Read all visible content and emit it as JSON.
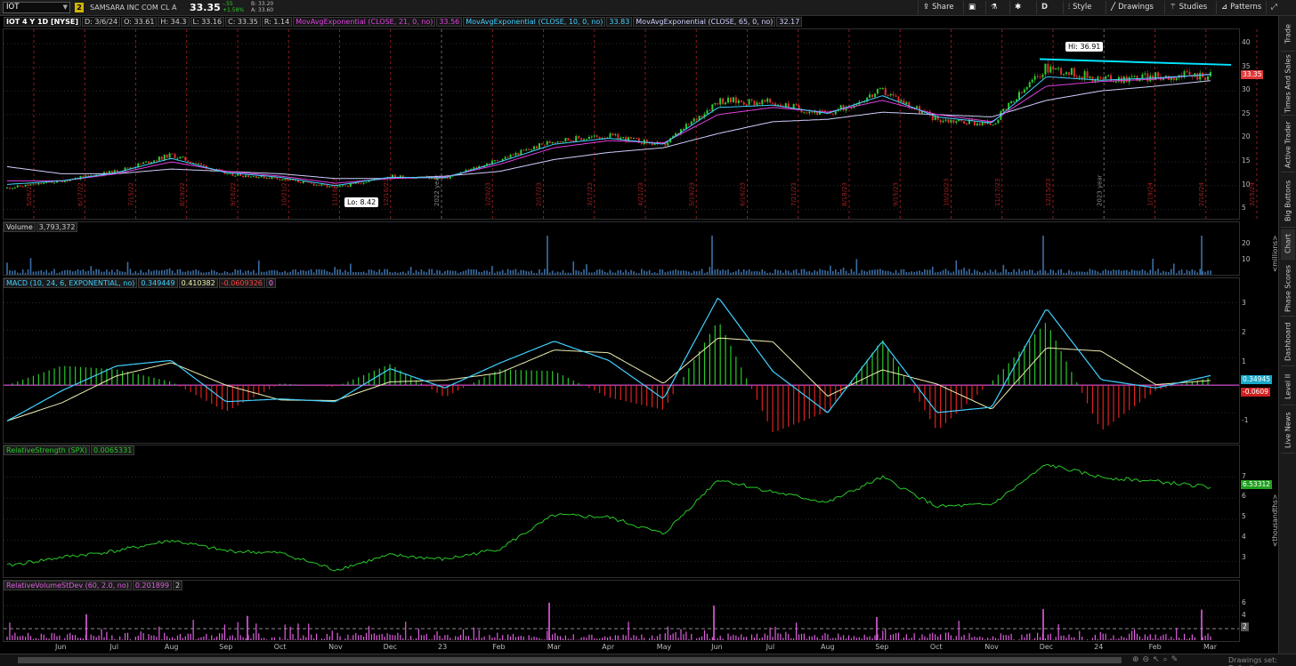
{
  "toolbar": {
    "symbol": "IOT",
    "badge": "2",
    "company": "SAMSARA INC COM CL A",
    "last": "33.35",
    "change_abs": "-.55",
    "change_pct": "+1.58%",
    "bid": "B: 33.20",
    "ask": "A: 33.60",
    "share": "Share",
    "period": "D",
    "style": "Style",
    "drawings": "Drawings",
    "studies": "Studies",
    "patterns": "Patterns"
  },
  "price_panel": {
    "header": {
      "symbol": "IOT 4 Y 1D [NYSE]",
      "date": "D: 3/6/24",
      "open": "O: 33.61",
      "high": "H: 34.3",
      "low": "L: 33.16",
      "close": "C: 33.35",
      "range": "R: 1.14",
      "ema1_label": "MovAvgExponential (CLOSE, 21, 0, no)",
      "ema1_value": "33.56",
      "ema2_label": "MovAvgExponential (CLOSE, 10, 0, no)",
      "ema2_value": "33.83",
      "ema3_label": "MovAvgExponential (CLOSE, 65, 0, no)",
      "ema3_value": "32.17"
    },
    "ticks": [
      "40",
      "35",
      "30",
      "25",
      "20",
      "15",
      "10",
      "5"
    ],
    "hi_label": "Hi: 36.91",
    "lo_label": "Lo: 8.42",
    "price_tag": "33.35",
    "date_markers": [
      "5/26/22",
      "6/17/22",
      "7/15/22",
      "8/19/22",
      "9/16/22",
      "10/21/22",
      "11/18/22",
      "12/16/22",
      "2022 year",
      "1/20/23",
      "2/17/23",
      "3/17/23",
      "4/21/23",
      "5/19/23",
      "6/16/23",
      "7/21/23",
      "8/18/23",
      "9/15/23",
      "10/20/23",
      "11/17/23",
      "12/15/23",
      "2023 year",
      "1/19/24",
      "2/16/24",
      "3/15/24"
    ]
  },
  "volume_panel": {
    "label": "Volume",
    "value": "3,793,372",
    "ticks": [
      "20",
      "10"
    ],
    "unit": "<millions>"
  },
  "macd_panel": {
    "label": "MACD (10, 24, 6, EXPONENTIAL, no)",
    "value": "0.349449",
    "avg": "0.410382",
    "diff": "-0.0609326",
    "zero": "0",
    "ticks": [
      "3",
      "2",
      "1",
      "-1"
    ],
    "tag_value": "0.34945",
    "tag_diff": "-0.0609"
  },
  "rs_panel": {
    "label": "RelativeStrength (SPX)",
    "value": "0.0065331",
    "ticks": [
      "7",
      "6",
      "5",
      "4",
      "3"
    ],
    "tag": "6.53312",
    "unit": "<thousandths>"
  },
  "rvol_panel": {
    "label": "RelativeVolumeStDev (60, 2.0, no)",
    "value": "0.201899",
    "threshold": "2",
    "ticks": [
      "6",
      "4",
      "2"
    ],
    "tag": "2"
  },
  "months": [
    "Jun",
    "Jul",
    "Aug",
    "Sep",
    "Oct",
    "Nov",
    "Dec",
    "23",
    "Feb",
    "Mar",
    "Apr",
    "May",
    "Jun",
    "Jul",
    "Aug",
    "Sep",
    "Oct",
    "Nov",
    "Dec",
    "24",
    "Feb",
    "Mar"
  ],
  "sidebar": [
    "Trade",
    "Times And Sales",
    "Active Trader",
    "Big Buttons",
    "Chart",
    "Phase Scores",
    "Dashboard",
    "Level II",
    "Live News"
  ],
  "bottom": {
    "drawings_set": "Drawings set: Default"
  },
  "colors": {
    "up": "#2ecc2e",
    "down": "#e03030",
    "ema21": "#e040e0",
    "ema10": "#40d0ff",
    "ema65": "#d0d0ff",
    "macd": "#40d0ff",
    "avg": "#f0f0b0",
    "rs": "#28c828",
    "rvol": "#e060e0",
    "trend": "#00e5ff"
  },
  "chart_data": [
    {
      "type": "line",
      "title": "IOT 4 Y 1D [NYSE]",
      "x": [
        "2022-05",
        "2022-06",
        "2022-07",
        "2022-08",
        "2022-09",
        "2022-10",
        "2022-11",
        "2022-12",
        "2023-01",
        "2023-02",
        "2023-03",
        "2023-04",
        "2023-05",
        "2023-06",
        "2023-07",
        "2023-08",
        "2023-09",
        "2023-10",
        "2023-11",
        "2023-12",
        "2024-01",
        "2024-02",
        "2024-03"
      ],
      "series": [
        {
          "name": "Price",
          "values": [
            9.5,
            11,
            13,
            16.5,
            12.5,
            11.5,
            9.5,
            12,
            11.5,
            15.5,
            19.5,
            20.5,
            18.5,
            28,
            27.5,
            25,
            30,
            24,
            23,
            35,
            32.5,
            33,
            33.35
          ]
        },
        {
          "name": "MovAvgExponential (CLOSE, 21, 0, no)",
          "values": [
            11,
            11,
            12.5,
            15,
            13,
            12,
            10.5,
            11.5,
            11.8,
            14.5,
            18,
            19.5,
            19,
            25,
            26.5,
            25.5,
            28,
            25,
            23.5,
            31,
            32,
            32.5,
            33.56
          ]
        },
        {
          "name": "MovAvgExponential (CLOSE, 65, 0, no)",
          "values": [
            14,
            12.5,
            12.5,
            13.5,
            13,
            12.5,
            11.5,
            11.5,
            12,
            13,
            15.5,
            17,
            18,
            21,
            23.5,
            24,
            25.5,
            25,
            24.5,
            28,
            30,
            31,
            32.17
          ]
        }
      ],
      "ylim": [
        3,
        43
      ]
    },
    {
      "type": "line",
      "title": "MACD (10, 24, 6, EXPONENTIAL, no)",
      "x": [
        "2022-05",
        "2022-06",
        "2022-07",
        "2022-08",
        "2022-09",
        "2022-10",
        "2022-11",
        "2022-12",
        "2023-01",
        "2023-02",
        "2023-03",
        "2023-04",
        "2023-05",
        "2023-06",
        "2023-07",
        "2023-08",
        "2023-09",
        "2023-10",
        "2023-11",
        "2023-12",
        "2024-01",
        "2024-02",
        "2024-03"
      ],
      "series": [
        {
          "name": "MACD",
          "values": [
            -1.3,
            -0.2,
            0.7,
            0.9,
            -0.6,
            -0.5,
            -0.6,
            0.6,
            -0.1,
            0.8,
            1.6,
            0.9,
            -0.5,
            3.2,
            0.5,
            -1,
            1.6,
            -1,
            -0.8,
            2.8,
            0.2,
            -0.1,
            0.35
          ]
        }
      ],
      "ylim": [
        -2,
        3.5
      ]
    },
    {
      "type": "line",
      "title": "RelativeStrength (SPX)",
      "x": [
        "2022-05",
        "2022-06",
        "2022-07",
        "2022-08",
        "2022-09",
        "2022-10",
        "2022-11",
        "2022-12",
        "2023-01",
        "2023-02",
        "2023-03",
        "2023-04",
        "2023-05",
        "2023-06",
        "2023-07",
        "2023-08",
        "2023-09",
        "2023-10",
        "2023-11",
        "2023-12",
        "2024-01",
        "2024-02",
        "2024-03"
      ],
      "series": [
        {
          "name": "RelativeStrength (SPX)",
          "values": [
            2.8,
            3.2,
            3.5,
            4,
            3.5,
            3.4,
            2.6,
            3.3,
            3.1,
            3.6,
            5.2,
            5.1,
            4.3,
            6.9,
            6.3,
            5.8,
            7,
            5.6,
            5.7,
            7.6,
            7,
            6.8,
            6.53
          ]
        }
      ],
      "ylim": [
        2.3,
        8
      ]
    }
  ]
}
